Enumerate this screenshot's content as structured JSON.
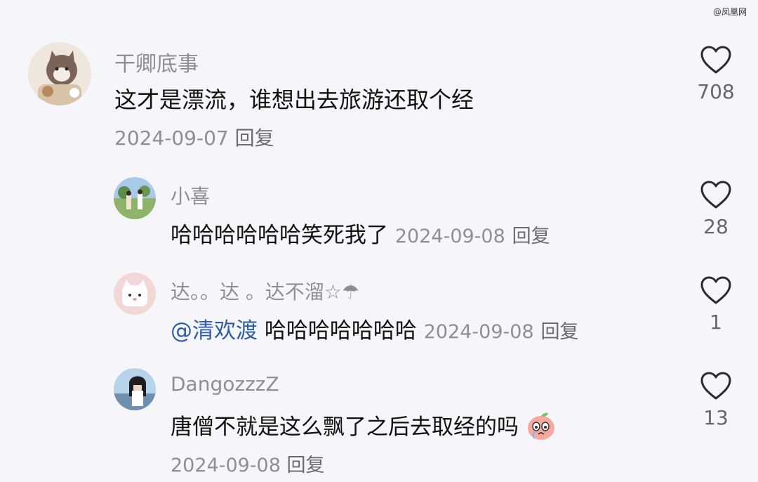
{
  "watermark": "@凤凰网",
  "comments": [
    {
      "username": "干卿底事",
      "text": "这才是漂流，谁想出去旅游还取个经",
      "date": "2024-09-07",
      "reply_label": "回复",
      "likes": "708",
      "avatar_icon": "cat-avatar-icon"
    },
    {
      "username": "小喜",
      "text": "哈哈哈哈哈哈笑死我了",
      "date": "2024-09-08",
      "reply_label": "回复",
      "likes": "28",
      "avatar_icon": "outdoor-photo-avatar-icon"
    },
    {
      "username": "达。。达 。达不溜☆☂",
      "mention": "@清欢渡",
      "text": "哈哈哈哈哈哈哈",
      "date": "2024-09-08",
      "reply_label": "回复",
      "likes": "1",
      "avatar_icon": "pink-cat-avatar-icon"
    },
    {
      "username": "DangozzzZ",
      "text": "唐僧不就是这么飘了之后去取经的吗",
      "date": "2024-09-08",
      "reply_label": "回复",
      "likes": "13",
      "avatar_icon": "person-photo-avatar-icon",
      "emoji_icon": "peach-crying-emoji-icon"
    }
  ],
  "colors": {
    "background": "#f6f6fa",
    "username": "#8e8e96",
    "text": "#111111",
    "mention": "#2d5da8",
    "like_icon": "#2b2b2b"
  }
}
